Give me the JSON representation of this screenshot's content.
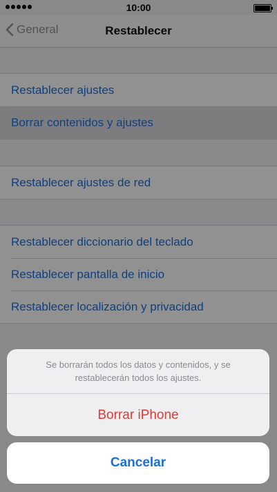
{
  "status_bar": {
    "time": "10:00"
  },
  "nav": {
    "back_label": "General",
    "title": "Restablecer"
  },
  "groups": [
    {
      "items": [
        "Restablecer ajustes",
        "Borrar contenidos y ajustes"
      ]
    },
    {
      "items": [
        "Restablecer ajustes de red"
      ]
    },
    {
      "items": [
        "Restablecer diccionario del teclado",
        "Restablecer pantalla de inicio",
        "Restablecer localización y privacidad"
      ]
    }
  ],
  "sheet": {
    "message": "Se borrarán todos los datos y contenidos, y se restablecerán todos los ajustes.",
    "destructive_label": "Borrar iPhone",
    "cancel_label": "Cancelar"
  },
  "colors": {
    "link": "#1a6fd8",
    "destructive": "#e8382f",
    "secondary": "#8e8e93"
  },
  "icons": [
    "signal-dots-icon",
    "battery-icon",
    "chevron-left-icon"
  ]
}
